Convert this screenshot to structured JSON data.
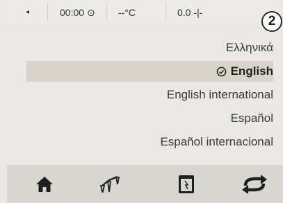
{
  "status_bar": {
    "back_glyph": "◂",
    "time": "00:00",
    "clock_glyph": "⊙",
    "temperature": "--°C",
    "value": "0.0",
    "balance_glyph": "-|-"
  },
  "step_badge": "2",
  "languages": [
    {
      "label": "Ελληνικά",
      "selected": false
    },
    {
      "label": "English",
      "selected": true
    },
    {
      "label": "English international",
      "selected": false
    },
    {
      "label": "Español",
      "selected": false
    },
    {
      "label": "Español internacional",
      "selected": false
    }
  ],
  "bottom_nav": {
    "items": [
      "home-icon",
      "scale-icon",
      "device-icon",
      "swap-icon"
    ]
  },
  "colors": {
    "background": "#e9e8e4",
    "selected_row": "#d9d4c9",
    "bottom_bar": "#d8d6d1",
    "icon": "#1f1f1f"
  }
}
